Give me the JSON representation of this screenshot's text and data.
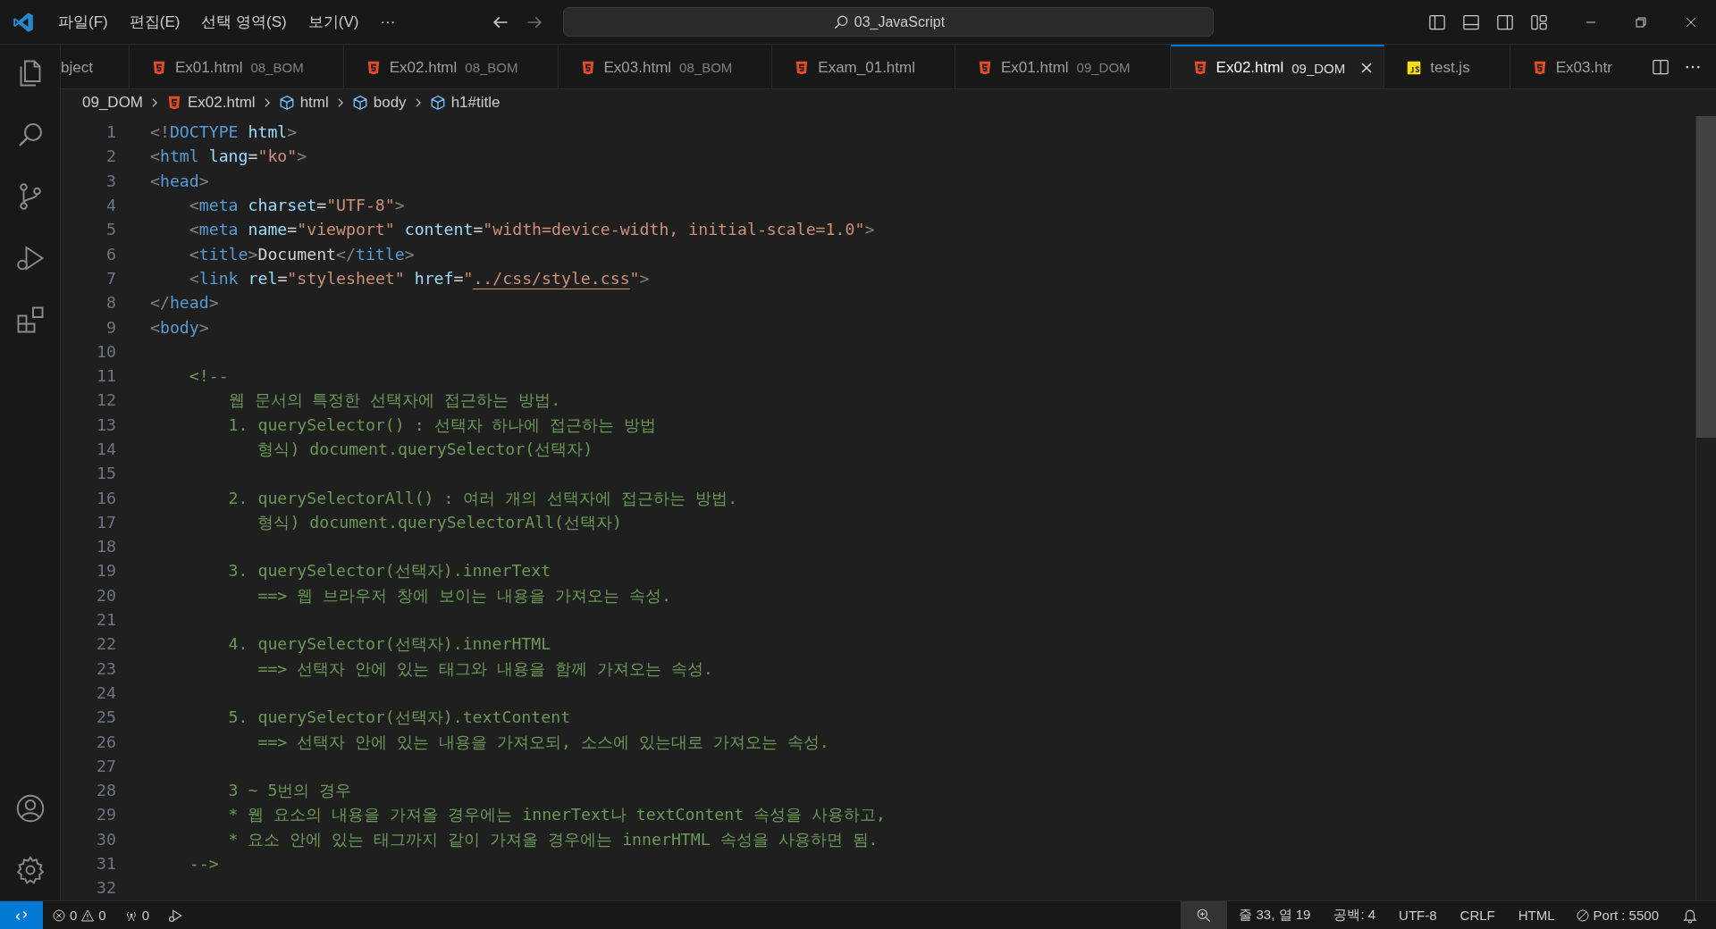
{
  "title_bar": {
    "menus": [
      "파일(F)",
      "편집(E)",
      "선택 영역(S)",
      "보기(V)",
      "···"
    ],
    "search": {
      "value": "03_JavaScript"
    }
  },
  "tabs": [
    {
      "label": "bject",
      "kind": "plain",
      "selected": false
    },
    {
      "label": "Ex01.html",
      "folder": "08_BOM",
      "kind": "html",
      "selected": false
    },
    {
      "label": "Ex02.html",
      "folder": "08_BOM",
      "kind": "html",
      "selected": false
    },
    {
      "label": "Ex03.html",
      "folder": "08_BOM",
      "kind": "html",
      "selected": false
    },
    {
      "label": "Exam_01.html",
      "kind": "html",
      "selected": false
    },
    {
      "label": "Ex01.html",
      "folder": "09_DOM",
      "kind": "html",
      "selected": false
    },
    {
      "label": "Ex02.html",
      "folder": "09_DOM",
      "kind": "html",
      "selected": true
    },
    {
      "label": "test.js",
      "kind": "js",
      "selected": false
    },
    {
      "label": "Ex03.htr",
      "kind": "html",
      "selected": false
    }
  ],
  "breadcrumb": [
    {
      "label": "09_DOM",
      "kind": "folder"
    },
    {
      "label": "Ex02.html",
      "kind": "html"
    },
    {
      "label": "html",
      "kind": "element"
    },
    {
      "label": "body",
      "kind": "element"
    },
    {
      "label": "h1#title",
      "kind": "element"
    }
  ],
  "code": [
    {
      "number": "1",
      "tokens": [
        {
          "kind": "punct",
          "text": "<!"
        },
        {
          "kind": "tag",
          "text": "DOCTYPE"
        },
        {
          "kind": "attr",
          "text": " html"
        },
        {
          "kind": "punct",
          "text": ">"
        }
      ]
    },
    {
      "number": "2",
      "tokens": [
        {
          "kind": "punct",
          "text": "<"
        },
        {
          "kind": "tag",
          "text": "html"
        },
        {
          "kind": "attr",
          "text": " lang"
        },
        {
          "kind": "text",
          "text": "="
        },
        {
          "kind": "string",
          "text": "\"ko\""
        },
        {
          "kind": "punct",
          "text": ">"
        }
      ]
    },
    {
      "number": "3",
      "tokens": [
        {
          "kind": "punct",
          "text": "<"
        },
        {
          "kind": "tag",
          "text": "head"
        },
        {
          "kind": "punct",
          "text": ">"
        }
      ]
    },
    {
      "number": "4",
      "tokens": [
        {
          "kind": "punct",
          "text": "    <"
        },
        {
          "kind": "tag",
          "text": "meta"
        },
        {
          "kind": "attr",
          "text": " charset"
        },
        {
          "kind": "text",
          "text": "="
        },
        {
          "kind": "string",
          "text": "\"UTF-8\""
        },
        {
          "kind": "punct",
          "text": ">"
        }
      ]
    },
    {
      "number": "5",
      "tokens": [
        {
          "kind": "punct",
          "text": "    <"
        },
        {
          "kind": "tag",
          "text": "meta"
        },
        {
          "kind": "attr",
          "text": " name"
        },
        {
          "kind": "text",
          "text": "="
        },
        {
          "kind": "string",
          "text": "\"viewport\""
        },
        {
          "kind": "attr",
          "text": " content"
        },
        {
          "kind": "text",
          "text": "="
        },
        {
          "kind": "string",
          "text": "\"width=device-width, initial-scale=1.0\""
        },
        {
          "kind": "punct",
          "text": ">"
        }
      ]
    },
    {
      "number": "6",
      "tokens": [
        {
          "kind": "punct",
          "text": "    <"
        },
        {
          "kind": "tag",
          "text": "title"
        },
        {
          "kind": "punct",
          "text": ">"
        },
        {
          "kind": "text",
          "text": "Document"
        },
        {
          "kind": "punct",
          "text": "</"
        },
        {
          "kind": "tag",
          "text": "title"
        },
        {
          "kind": "punct",
          "text": ">"
        }
      ]
    },
    {
      "number": "7",
      "tokens": [
        {
          "kind": "punct",
          "text": "    <"
        },
        {
          "kind": "tag",
          "text": "link"
        },
        {
          "kind": "attr",
          "text": " rel"
        },
        {
          "kind": "text",
          "text": "="
        },
        {
          "kind": "string",
          "text": "\"stylesheet\""
        },
        {
          "kind": "attr",
          "text": " href"
        },
        {
          "kind": "text",
          "text": "="
        },
        {
          "kind": "string",
          "text": "\""
        },
        {
          "kind": "link",
          "text": "../css/style.css"
        },
        {
          "kind": "string",
          "text": "\""
        },
        {
          "kind": "punct",
          "text": ">"
        }
      ]
    },
    {
      "number": "8",
      "tokens": [
        {
          "kind": "punct",
          "text": "</"
        },
        {
          "kind": "tag",
          "text": "head"
        },
        {
          "kind": "punct",
          "text": ">"
        }
      ]
    },
    {
      "number": "9",
      "tokens": [
        {
          "kind": "punct",
          "text": "<"
        },
        {
          "kind": "tag",
          "text": "body"
        },
        {
          "kind": "punct",
          "text": ">"
        }
      ]
    },
    {
      "number": "10"
    },
    {
      "number": "11",
      "tokens": [
        {
          "kind": "comment",
          "text": "    <!--"
        }
      ]
    },
    {
      "number": "12",
      "tokens": [
        {
          "kind": "comment",
          "text": "        웹 문서의 특정한 선택자에 접근하는 방법."
        }
      ]
    },
    {
      "number": "13",
      "tokens": [
        {
          "kind": "comment",
          "text": "        1. querySelector() : 선택자 하나에 접근하는 방법"
        }
      ]
    },
    {
      "number": "14",
      "tokens": [
        {
          "kind": "comment",
          "text": "           형식) document.querySelector(선택자)"
        }
      ]
    },
    {
      "number": "15"
    },
    {
      "number": "16",
      "tokens": [
        {
          "kind": "comment",
          "text": "        2. querySelectorAll() : 여러 개의 선택자에 접근하는 방법."
        }
      ]
    },
    {
      "number": "17",
      "tokens": [
        {
          "kind": "comment",
          "text": "           형식) document.querySelectorAll(선택자)"
        }
      ]
    },
    {
      "number": "18"
    },
    {
      "number": "19",
      "tokens": [
        {
          "kind": "comment",
          "text": "        3. querySelector(선택자).innerText"
        }
      ]
    },
    {
      "number": "20",
      "tokens": [
        {
          "kind": "comment",
          "text": "           ==> 웹 브라우저 창에 보이는 내용을 가져오는 속성."
        }
      ]
    },
    {
      "number": "21"
    },
    {
      "number": "22",
      "tokens": [
        {
          "kind": "comment",
          "text": "        4. querySelector(선택자).innerHTML"
        }
      ]
    },
    {
      "number": "23",
      "tokens": [
        {
          "kind": "comment",
          "text": "           ==> 선택자 안에 있는 태그와 내용을 함께 가져오는 속성."
        }
      ]
    },
    {
      "number": "24"
    },
    {
      "number": "25",
      "tokens": [
        {
          "kind": "comment",
          "text": "        5. querySelector(선택자).textContent"
        }
      ]
    },
    {
      "number": "26",
      "tokens": [
        {
          "kind": "comment",
          "text": "           ==> 선택자 안에 있는 내용을 가져오되, 소스에 있는대로 가져오는 속성."
        }
      ]
    },
    {
      "number": "27"
    },
    {
      "number": "28",
      "tokens": [
        {
          "kind": "comment",
          "text": "        3 ~ 5번의 경우"
        }
      ]
    },
    {
      "number": "29",
      "tokens": [
        {
          "kind": "comment",
          "text": "        * 웹 요소의 내용을 가져올 경우에는 innerText나 textContent 속성을 사용하고,"
        }
      ]
    },
    {
      "number": "30",
      "tokens": [
        {
          "kind": "comment",
          "text": "        * 요소 안에 있는 태그까지 같이 가져올 경우에는 innerHTML 속성을 사용하면 됨."
        }
      ]
    },
    {
      "number": "31",
      "tokens": [
        {
          "kind": "comment",
          "text": "    -->"
        }
      ]
    },
    {
      "number": "32"
    }
  ],
  "status_bar": {
    "errors": "0",
    "warnings": "0",
    "ports": "0",
    "cursor": "줄 33, 열 19",
    "indentation": "공백: 4",
    "encoding": "UTF-8",
    "line_ending": "CRLF",
    "language": "HTML",
    "live_server": "Port : 5500"
  }
}
